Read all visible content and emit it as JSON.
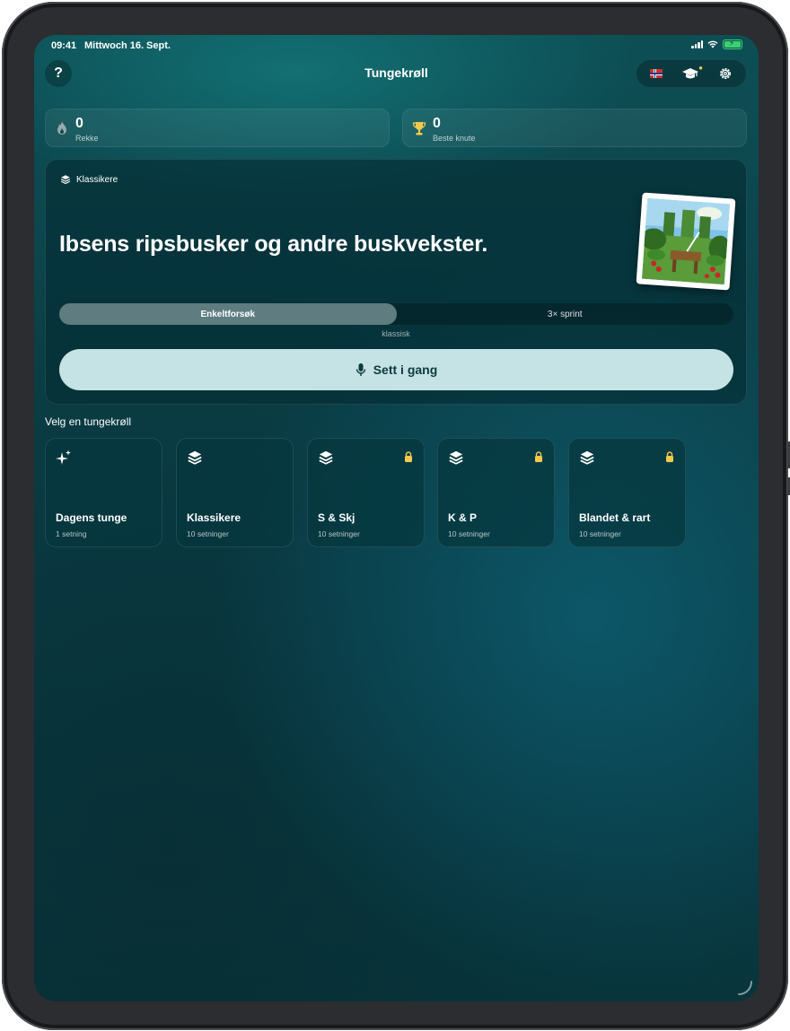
{
  "status_bar": {
    "time": "09:41",
    "date": "Mittwoch 16. Sept."
  },
  "nav": {
    "help_label": "?",
    "title": "Tungekrøll",
    "icons": [
      "norway-flag-icon",
      "graduation-cap-icon",
      "gear-icon"
    ]
  },
  "stats": [
    {
      "value": "0",
      "label": "Rekke",
      "icon": "flame-icon"
    },
    {
      "value": "0",
      "label": "Beste knute",
      "icon": "trophy-icon"
    }
  ],
  "hero": {
    "category": "Klassikere",
    "sentence": "Ibsens ripsbusker og andre buskvekster.",
    "modes": [
      "Enkeltforsøk",
      "3× sprint"
    ],
    "selected_mode": "Enkeltforsøk",
    "mode_caption": "klassisk",
    "start_label": "Sett i gang"
  },
  "section_title": "Velg en tungekrøll",
  "packs": [
    {
      "title": "Dagens tunge",
      "subtitle": "1 setning",
      "icon": "sparkles-icon",
      "locked": false
    },
    {
      "title": "Klassikere",
      "subtitle": "10 setninger",
      "icon": "stack-icon",
      "locked": false
    },
    {
      "title": "S & Skj",
      "subtitle": "10 setninger",
      "icon": "stack-icon",
      "locked": true
    },
    {
      "title": "K & P",
      "subtitle": "10 setninger",
      "icon": "stack-icon",
      "locked": true
    },
    {
      "title": "Blandet & rart",
      "subtitle": "10 setninger",
      "icon": "stack-icon",
      "locked": true
    }
  ],
  "colors": {
    "background": "#0b4048",
    "accent_button": "#c5e3e4",
    "lock": "#f2c94c",
    "trophy": "#f2c94c",
    "battery": "#3bd16f"
  }
}
